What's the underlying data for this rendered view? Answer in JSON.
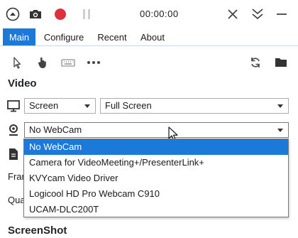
{
  "window": {
    "timer": "00:00:00"
  },
  "tabs": [
    {
      "label": "Main"
    },
    {
      "label": "Configure"
    },
    {
      "label": "Recent"
    },
    {
      "label": "About"
    }
  ],
  "colors": {
    "accent": "#1b79d9",
    "record": "#e0303b"
  },
  "video": {
    "section_title": "Video",
    "source": "Screen",
    "screen_mode": "Full Screen",
    "webcam": "No WebCam",
    "webcam_options": [
      "No WebCam",
      "Camera for VideoMeeting+/PresenterLink+",
      "KVYcam Video Driver",
      "Logicool HD Pro Webcam C910",
      "UCAM-DLC200T"
    ],
    "frame_label_partial": "Fran",
    "quality_label_partial": "Qua"
  },
  "screenshot": {
    "section_title": "ScreenShot"
  }
}
